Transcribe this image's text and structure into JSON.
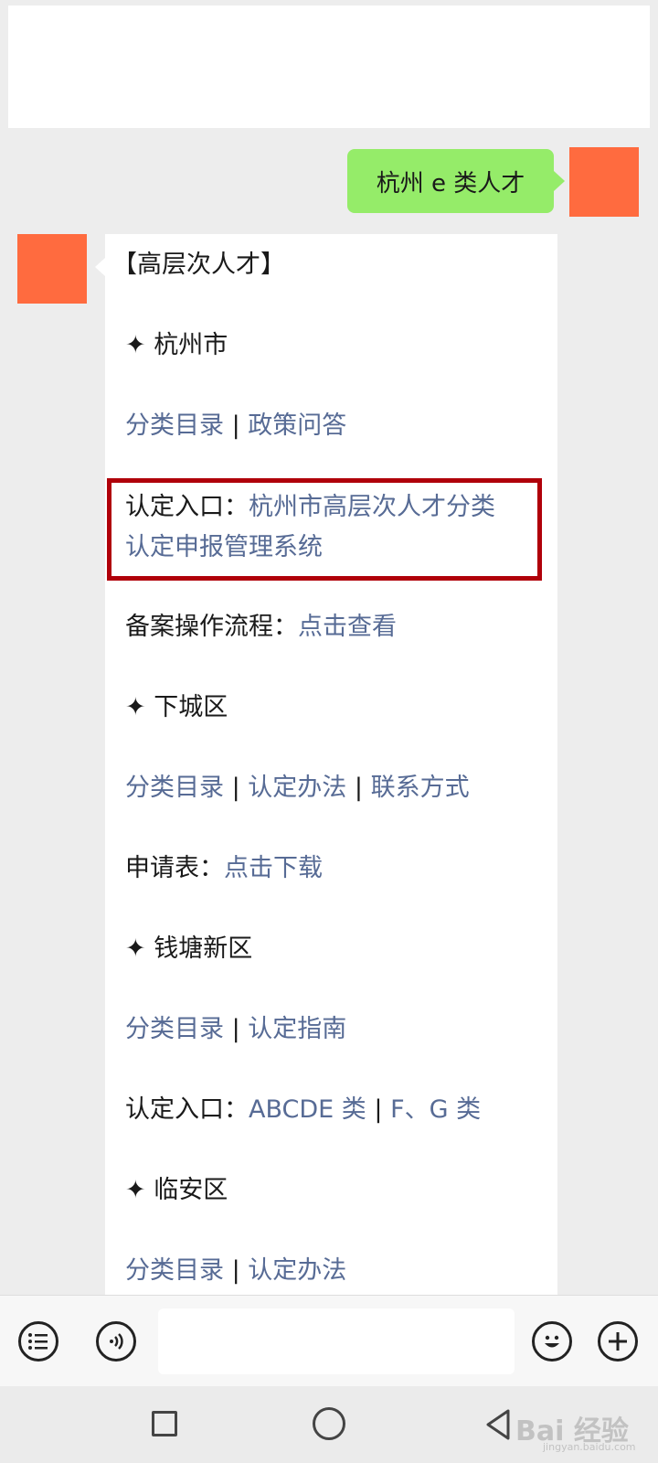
{
  "chat": {
    "sent_message": "杭州 e 类人才",
    "reply": {
      "header": "【高层次人才】",
      "star_glyph": "✦",
      "sections": [
        {
          "title": "杭州市",
          "link_row": [
            "分类目录",
            "政策问答"
          ],
          "entry_label": "认定入口：",
          "entry_link_line1": "杭州市高层次人才分类",
          "entry_link_line2": "认定申报管理系统",
          "record_label": "备案操作流程：",
          "record_link": "点击查看"
        },
        {
          "title": "下城区",
          "link_row": [
            "分类目录",
            "认定办法",
            "联系方式"
          ],
          "form_label": "申请表：",
          "form_link": "点击下载"
        },
        {
          "title": "钱塘新区",
          "link_row": [
            "分类目录",
            "认定指南"
          ],
          "entry_label": "认定入口：",
          "entry_links": [
            "ABCDE 类",
            "F、G 类"
          ]
        },
        {
          "title": "临安区",
          "link_row_partial": [
            "分类目录",
            "认定办法"
          ]
        }
      ],
      "separator": "|"
    }
  },
  "input_bar": {
    "icons": [
      "list-icon",
      "voice-icon",
      "emoji-icon",
      "plus-icon"
    ]
  },
  "watermark": {
    "text": "Bai 经验",
    "sub": "jingyan.baidu.com"
  },
  "colors": {
    "sent_bubble": "#95ec69",
    "link": "#576b95",
    "highlight_border": "#b0000a",
    "avatar": "#ff6b3f"
  }
}
